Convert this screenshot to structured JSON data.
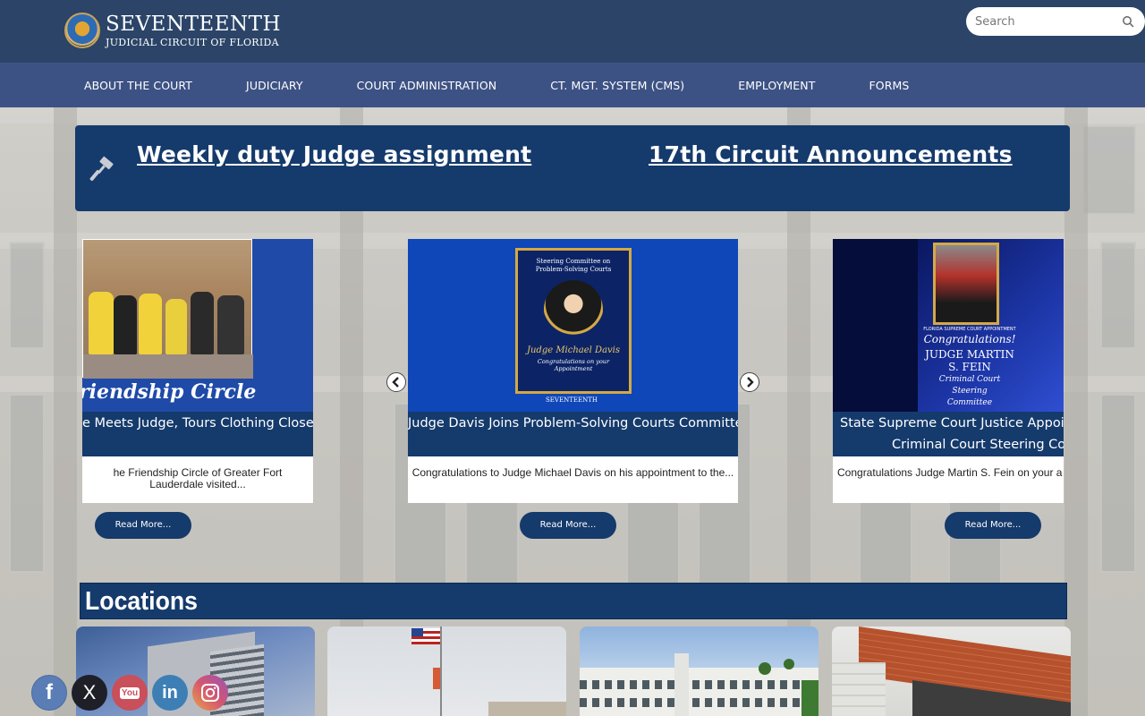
{
  "header": {
    "logo_title": "SEVENTEENTH",
    "logo_subtitle": "JUDICIAL CIRCUIT OF FLORIDA",
    "search_placeholder": "Search"
  },
  "nav": {
    "items": [
      {
        "label": "ABOUT THE COURT"
      },
      {
        "label": "JUDICIARY"
      },
      {
        "label": "COURT ADMINISTRATION"
      },
      {
        "label": "CT. MGT. SYSTEM (CMS)"
      },
      {
        "label": "EMPLOYMENT"
      },
      {
        "label": "FORMS"
      }
    ]
  },
  "banner": {
    "link1": "Weekly duty Judge assignment",
    "link2": "17th Circuit Announcements"
  },
  "carousel": {
    "read_more": "Read More...",
    "cards": [
      {
        "image_text": "riendship Circle",
        "caption": "e Meets Judge, Tours Clothing Closet",
        "excerpt": "he Friendship Circle of Greater Fort Lauderdale visited..."
      },
      {
        "image_heading": "Steering Committee on Problem-Solving Courts",
        "image_name": "Judge Michael Davis",
        "image_sub": "Congratulations on your Appointment",
        "image_footer": "SEVENTEENTH",
        "caption": "Judge Davis Joins Problem-Solving Courts Committee",
        "excerpt": "Congratulations to Judge Michael Davis on his appointment to the..."
      },
      {
        "image_heading": "FLORIDA SUPREME COURT APPOINTMENT",
        "image_congrats": "Congratulations!",
        "image_name_line1": "JUDGE MARTIN",
        "image_name_line2": "S. FEIN",
        "image_sub_line1": "Criminal Court",
        "image_sub_line2": "Steering",
        "image_sub_line3": "Committee",
        "caption_line1": "State Supreme Court Justice Appoint",
        "caption_line2": "Criminal Court Steering Com",
        "excerpt": "Congratulations Judge Martin S. Fein on your a"
      }
    ]
  },
  "locations": {
    "title": "Locations"
  },
  "social": {
    "facebook": "f",
    "x": "X",
    "youtube": "You",
    "linkedin": "in"
  },
  "colors": {
    "header": "#2b4468",
    "nav": "#3d5284",
    "accent": "#153a6c"
  }
}
